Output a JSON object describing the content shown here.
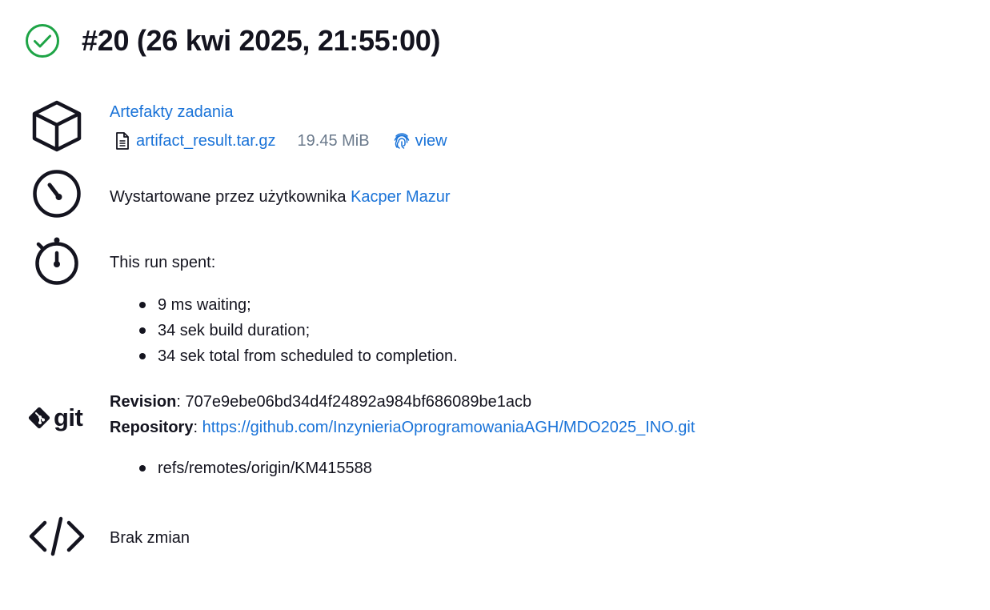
{
  "header": {
    "title": "#20 (26 kwi 2025, 21:55:00)",
    "status_icon": "success-check-circle-icon",
    "status_color": "#1ea446"
  },
  "artifacts": {
    "icon": "package-cube-icon",
    "heading": "Artefakty zadania",
    "file": {
      "icon": "document-icon",
      "name": "artifact_result.tar.gz",
      "size": "19.45 MiB",
      "fingerprint_icon": "fingerprint-icon",
      "view_label": "view"
    }
  },
  "started": {
    "icon": "timer-dial-icon",
    "text": "Wystartowane przez użytkownika",
    "user": "Kacper Mazur"
  },
  "timing": {
    "icon": "stopwatch-icon",
    "heading": "This run spent:",
    "items": [
      "9 ms waiting;",
      "34 sek build duration;",
      "34 sek total from scheduled to completion."
    ]
  },
  "git": {
    "icon": "git-logo-icon",
    "logo_text": "git",
    "revision_label": "Revision",
    "revision_value": "707e9ebe06bd34d4f24892a984bf686089be1acb",
    "repository_label": "Repository",
    "repository_url": "https://github.com/InzynieriaOprogramowaniaAGH/MDO2025_INO.git",
    "branches": [
      "refs/remotes/origin/KM415588"
    ]
  },
  "changes": {
    "icon": "code-brackets-icon",
    "text": "Brak zmian"
  },
  "colors": {
    "link": "#1a73d8",
    "text": "#14141f",
    "muted": "#6b7a8c"
  }
}
